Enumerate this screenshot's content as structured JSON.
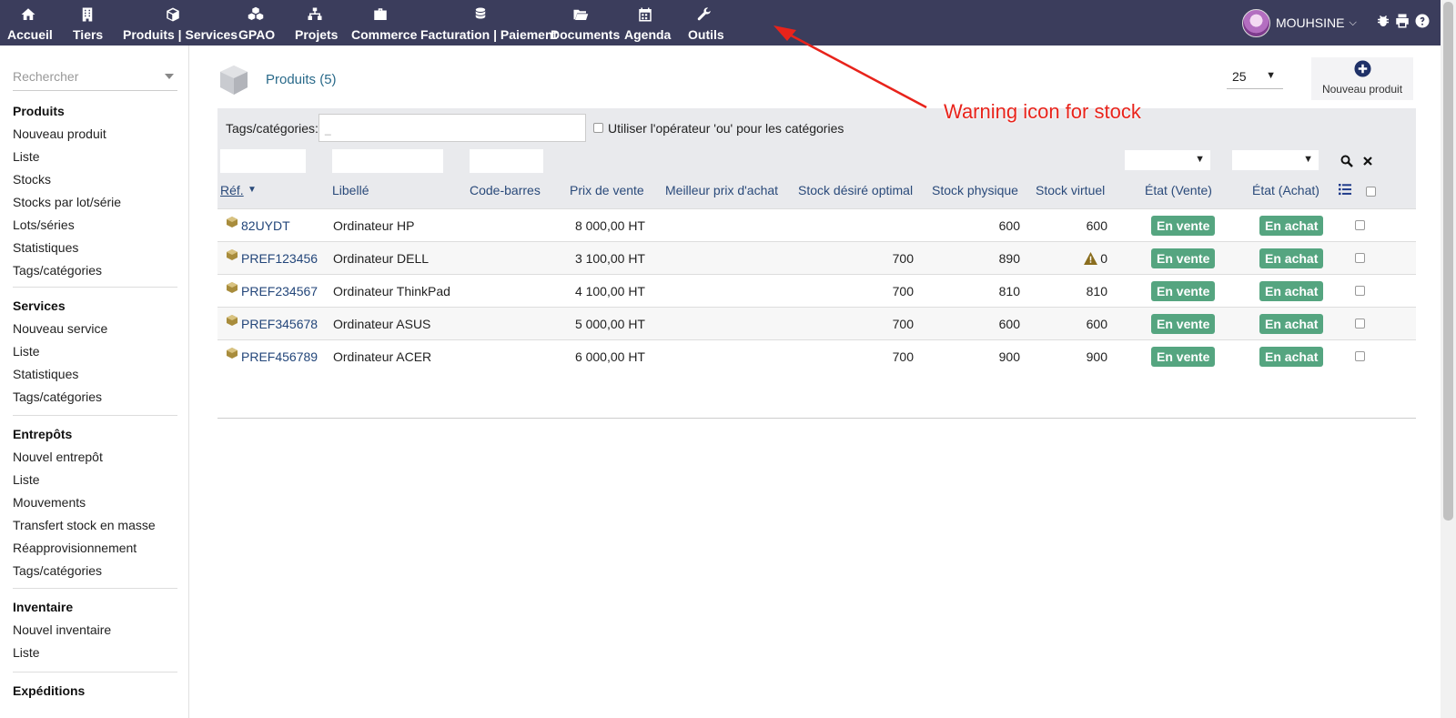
{
  "topbar": {
    "items": [
      {
        "label": "Accueil",
        "icon": "home-icon"
      },
      {
        "label": "Tiers",
        "icon": "building-icon"
      },
      {
        "label": "Produits | Services",
        "icon": "cube-icon"
      },
      {
        "label": "GPAO",
        "icon": "cubes-icon"
      },
      {
        "label": "Projets",
        "icon": "sitemap-icon"
      },
      {
        "label": "Commerce",
        "icon": "suitcase-icon"
      },
      {
        "label": "Facturation | Paiement",
        "icon": "coins-icon"
      },
      {
        "label": "Documents",
        "icon": "folder-icon"
      },
      {
        "label": "Agenda",
        "icon": "calendar-icon"
      },
      {
        "label": "Outils",
        "icon": "wrench-icon"
      }
    ],
    "user": "MOUHSINE",
    "colors": {
      "bar": "#3b3d5c",
      "badge": "#55a580",
      "link": "#23467a"
    }
  },
  "annotation": {
    "text": "Warning icon for stock"
  },
  "sidebar": {
    "search_placeholder": "Rechercher",
    "groups": [
      {
        "title": "Produits",
        "links": [
          "Nouveau produit",
          "Liste",
          "Stocks",
          "Stocks par lot/série",
          "Lots/séries",
          "Statistiques",
          "Tags/catégories"
        ]
      },
      {
        "title": "Services",
        "links": [
          "Nouveau service",
          "Liste",
          "Statistiques",
          "Tags/catégories"
        ]
      },
      {
        "title": "Entrepôts",
        "links": [
          "Nouvel entrepôt",
          "Liste",
          "Mouvements",
          "Transfert stock en masse",
          "Réapprovisionnement",
          "Tags/catégories"
        ]
      },
      {
        "title": "Inventaire",
        "links": [
          "Nouvel inventaire",
          "Liste"
        ]
      },
      {
        "title": "Expéditions",
        "links": []
      }
    ]
  },
  "main": {
    "title": "Produits (5)",
    "limit": "25",
    "new_button": "Nouveau produit",
    "filters": {
      "tags_label": "Tags/catégories:",
      "tags_placeholder": "_",
      "or_label": "Utiliser l'opérateur 'ou' pour les catégories"
    },
    "columns": [
      "Réf.",
      "Libellé",
      "Code-barres",
      "Prix de vente",
      "Meilleur prix d'achat",
      "Stock désiré optimal",
      "Stock physique",
      "Stock virtuel",
      "État (Vente)",
      "État (Achat)"
    ],
    "rows": [
      {
        "ref": "82UYDT",
        "label": "Ordinateur HP",
        "barcode": "",
        "price": "8 000,00 HT",
        "best_buy": "",
        "desired": "",
        "physical": "600",
        "virtual": "600",
        "warning": false,
        "sell": "En vente",
        "buy": "En achat"
      },
      {
        "ref": "PREF123456",
        "label": "Ordinateur DELL",
        "barcode": "",
        "price": "3 100,00 HT",
        "best_buy": "",
        "desired": "700",
        "physical": "890",
        "virtual": "0",
        "warning": true,
        "sell": "En vente",
        "buy": "En achat"
      },
      {
        "ref": "PREF234567",
        "label": "Ordinateur ThinkPad",
        "barcode": "",
        "price": "4 100,00 HT",
        "best_buy": "",
        "desired": "700",
        "physical": "810",
        "virtual": "810",
        "warning": false,
        "sell": "En vente",
        "buy": "En achat"
      },
      {
        "ref": "PREF345678",
        "label": "Ordinateur ASUS",
        "barcode": "",
        "price": "5 000,00 HT",
        "best_buy": "",
        "desired": "700",
        "physical": "600",
        "virtual": "600",
        "warning": false,
        "sell": "En vente",
        "buy": "En achat"
      },
      {
        "ref": "PREF456789",
        "label": "Ordinateur ACER",
        "barcode": "",
        "price": "6 000,00 HT",
        "best_buy": "",
        "desired": "700",
        "physical": "900",
        "virtual": "900",
        "warning": false,
        "sell": "En vente",
        "buy": "En achat"
      }
    ]
  }
}
